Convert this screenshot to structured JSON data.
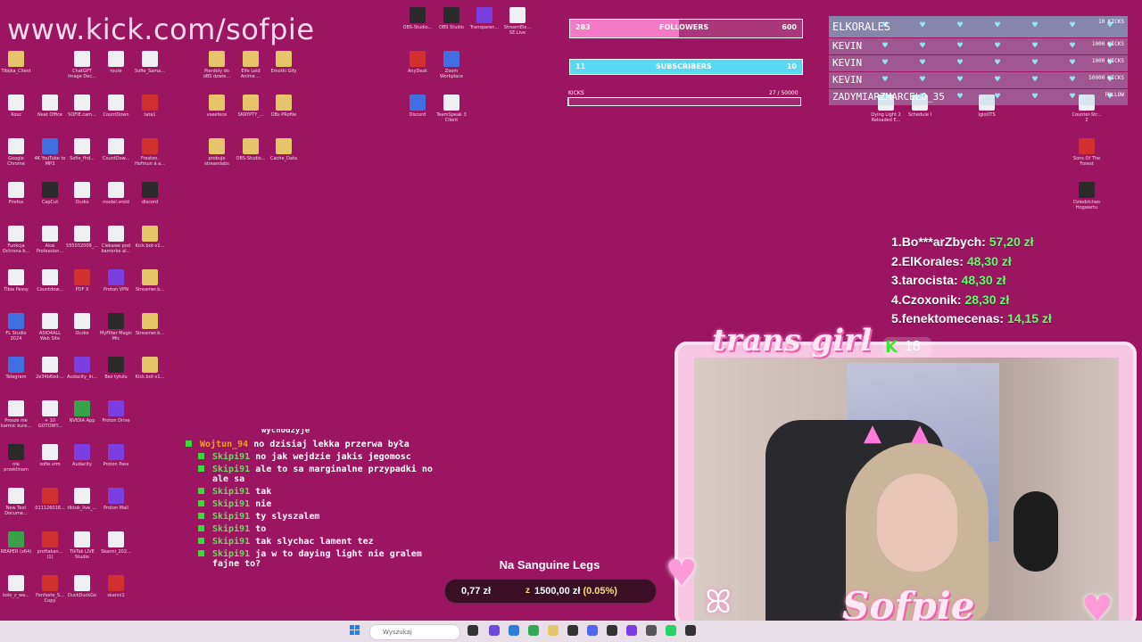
{
  "overlay": {
    "url": "www.kick.com/sofpie",
    "followers": {
      "label": "FOLLOWERS",
      "current": "283",
      "goal": "600",
      "progress": 0.47
    },
    "subscribers": {
      "label": "SUBSCRIBERS",
      "current": "11",
      "goal": "10",
      "progress": 1.0
    },
    "kicks": {
      "label": "KICKS",
      "value": "27  / 50000",
      "progress": 0.0005
    },
    "events": [
      {
        "name": "ELKORALES",
        "amount": "10 KICKS"
      },
      {
        "name": "KEVIN",
        "amount": "1000 KICKS"
      },
      {
        "name": "KEVIN",
        "amount": "1000 KICKS"
      },
      {
        "name": "KEVIN",
        "amount": "50000 KICKS"
      },
      {
        "name": "ZADYMIARZMARCELO_35",
        "amount": "FOLLOW"
      }
    ],
    "leaderboard": [
      {
        "rank": "1.",
        "name": "Bo***arZbych:",
        "amount": "57,20 zł"
      },
      {
        "rank": "2.",
        "name": "ElKorales:",
        "amount": "48,30 zł"
      },
      {
        "rank": "3.",
        "name": "tarocista:",
        "amount": "48,30 zł"
      },
      {
        "rank": "4.",
        "name": "Czoxonik:",
        "amount": "28,30 zł"
      },
      {
        "rank": "5.",
        "name": "fenektomecenas:",
        "amount": "14,15 zł"
      }
    ],
    "chat_top_fragment": "wychodzyje",
    "chat": [
      {
        "user": "Wojtun_94",
        "msg": "no dzisiaj lekka przerwa była",
        "highlight": true
      },
      {
        "user": "Skipi91",
        "msg": "no jak wejdzie jakis jegomosc",
        "highlight": false
      },
      {
        "user": "Skipi91",
        "msg": "ale to sa marginalne przypadki no ale sa",
        "highlight": false
      },
      {
        "user": "Skipi91",
        "msg": "tak",
        "highlight": false
      },
      {
        "user": "Skipi91",
        "msg": "nie",
        "highlight": false
      },
      {
        "user": "Skipi91",
        "msg": "ty slyszalem",
        "highlight": false
      },
      {
        "user": "Skipi91",
        "msg": "to",
        "highlight": false
      },
      {
        "user": "Skipi91",
        "msg": "tak slychac lament tez",
        "highlight": false
      },
      {
        "user": "Skipi91",
        "msg": "ja w to daying light nie gralem fajne to?",
        "highlight": false
      }
    ],
    "sanguine": {
      "title": "Na Sanguine Legs",
      "left": "0,77 zł",
      "currency": "z",
      "right": "1500,00 zł",
      "percent": "(0.05%)"
    },
    "cam": {
      "title_top": "trans girl",
      "kick_badge": "K",
      "viewers": "18",
      "title_bottom": "Sofpie"
    }
  },
  "desktop_icons": [
    {
      "label": "ChatGPT Image Dec...",
      "kind": "file"
    },
    {
      "label": "route",
      "kind": "file"
    },
    {
      "label": "Tibijka_Client",
      "kind": "folder"
    },
    {
      "label": "Sofie_Sama...",
      "kind": "file"
    },
    {
      "label": "Kosz",
      "kind": "file"
    },
    {
      "label": "Neat Office",
      "kind": "file"
    },
    {
      "label": "SOFIE.cam...",
      "kind": "file"
    },
    {
      "label": "CountDown",
      "kind": "file"
    },
    {
      "label": "tata1",
      "kind": "pdf"
    },
    {
      "label": "Google Chrome",
      "kind": "file"
    },
    {
      "label": "4K YouTube to MP3",
      "kind": "blue"
    },
    {
      "label": "Sofie_fhd...",
      "kind": "file"
    },
    {
      "label": "CountDow...",
      "kind": "file"
    },
    {
      "label": "Freston. Hofmun á a...",
      "kind": "pdf"
    },
    {
      "label": "Firefox",
      "kind": "file"
    },
    {
      "label": "CapCut",
      "kind": "dark"
    },
    {
      "label": "Oczko",
      "kind": "file"
    },
    {
      "label": "model.vroid",
      "kind": "file"
    },
    {
      "label": "discord",
      "kind": "dark"
    },
    {
      "label": "Funkcja Ochrona b...",
      "kind": "file"
    },
    {
      "label": "Akai Profession...",
      "kind": "file"
    },
    {
      "label": "555032009_...",
      "kind": "file"
    },
    {
      "label": "Ciekawe pod kamerke al...",
      "kind": "file"
    },
    {
      "label": "Kick.bot-v1...",
      "kind": "folder"
    },
    {
      "label": "Tibia Pessy",
      "kind": "file"
    },
    {
      "label": "Countdow...",
      "kind": "file"
    },
    {
      "label": "PDF X",
      "kind": "pdf"
    },
    {
      "label": "Proton VPN",
      "kind": "purple"
    },
    {
      "label": "Streamer.b...",
      "kind": "folder"
    },
    {
      "label": "FL Studio 2024",
      "kind": "blue"
    },
    {
      "label": "ASIO4ALL Web Site",
      "kind": "file"
    },
    {
      "label": "Oczko",
      "kind": "file"
    },
    {
      "label": "MyFilter Magic Mic",
      "kind": "dark"
    },
    {
      "label": "Streamer.b...",
      "kind": "folder"
    },
    {
      "label": "Telegram",
      "kind": "blue"
    },
    {
      "label": "2e34b6ed-...",
      "kind": "file"
    },
    {
      "label": "Audacity_In...",
      "kind": "purple"
    },
    {
      "label": "Bez tytułu",
      "kind": "dark"
    },
    {
      "label": "Kick.bot-v1...",
      "kind": "folder"
    },
    {
      "label": "Prosze nie karmic kure...",
      "kind": "file"
    },
    {
      "label": "+ 10 GOTOWY...",
      "kind": "file"
    },
    {
      "label": "NVIDIA App",
      "kind": "green"
    },
    {
      "label": "Proton Drive",
      "kind": "purple"
    },
    {
      "label": "nie przeklinam",
      "kind": "dark"
    },
    {
      "label": "sofie.vrm",
      "kind": "file"
    },
    {
      "label": "Audacity",
      "kind": "purple"
    },
    {
      "label": "Proton Pass",
      "kind": "purple"
    },
    {
      "label": "New Text Docume...",
      "kind": "file"
    },
    {
      "label": "011126016...",
      "kind": "pdf"
    },
    {
      "label": "tiktok_live_...",
      "kind": "file"
    },
    {
      "label": "Proton Mail",
      "kind": "purple"
    },
    {
      "label": "REAPER (x64)",
      "kind": "green"
    },
    {
      "label": "proftakan... (1)",
      "kind": "pdf"
    },
    {
      "label": "TikTok LIVE Studio",
      "kind": "file"
    },
    {
      "label": "Skanni_202...",
      "kind": "file"
    },
    {
      "label": "kolo_z_wa...",
      "kind": "file"
    },
    {
      "label": "Fenfaste_S... Copy",
      "kind": "pdf"
    },
    {
      "label": "DuckDuckGo",
      "kind": "file"
    },
    {
      "label": "skanni1",
      "kind": "pdf"
    },
    {
      "label": "Pierdoly do oBS dzwie...",
      "kind": "folder"
    },
    {
      "label": "Elfe Leid Anime ...",
      "kind": "folder"
    },
    {
      "label": "Emotki Gify",
      "kind": "folder"
    },
    {
      "label": "vseefece",
      "kind": "folder"
    },
    {
      "label": "SKRYPTY_...",
      "kind": "folder"
    },
    {
      "label": "OBs PRofile",
      "kind": "folder"
    },
    {
      "label": "probuje streamlabs",
      "kind": "folder"
    },
    {
      "label": "OBS-Studio...",
      "kind": "folder"
    },
    {
      "label": "Cache_Data",
      "kind": "folder"
    },
    {
      "label": "OBS-Studio...",
      "kind": "dark"
    },
    {
      "label": "OBS Studio",
      "kind": "dark"
    },
    {
      "label": "Transparen...",
      "kind": "purple"
    },
    {
      "label": "StreamEle... SE.Live",
      "kind": "file"
    },
    {
      "label": "AnyDesk",
      "kind": "pdf"
    },
    {
      "label": "Zoom Workplace",
      "kind": "blue"
    },
    {
      "label": "Discord",
      "kind": "blue"
    },
    {
      "label": "TeamSpeak 3 Client",
      "kind": "file"
    },
    {
      "label": "Dying Light 2 Reloaded E...",
      "kind": "file"
    },
    {
      "label": "Schedule I",
      "kind": "file"
    },
    {
      "label": "IgloOTS",
      "kind": "file"
    },
    {
      "label": "Counter-Str... 2",
      "kind": "file"
    },
    {
      "label": "Sons Of The Forest",
      "kind": "pdf"
    },
    {
      "label": "Dziedzictwo Hogwartu",
      "kind": "dark"
    }
  ],
  "taskbar": {
    "search_placeholder": "Wyszukaj"
  },
  "colors": {
    "desktop": "#9c1560",
    "accent_green": "#5dff6a",
    "followers_fill": "#f47ac6",
    "subs_fill": "#58d8f2"
  }
}
